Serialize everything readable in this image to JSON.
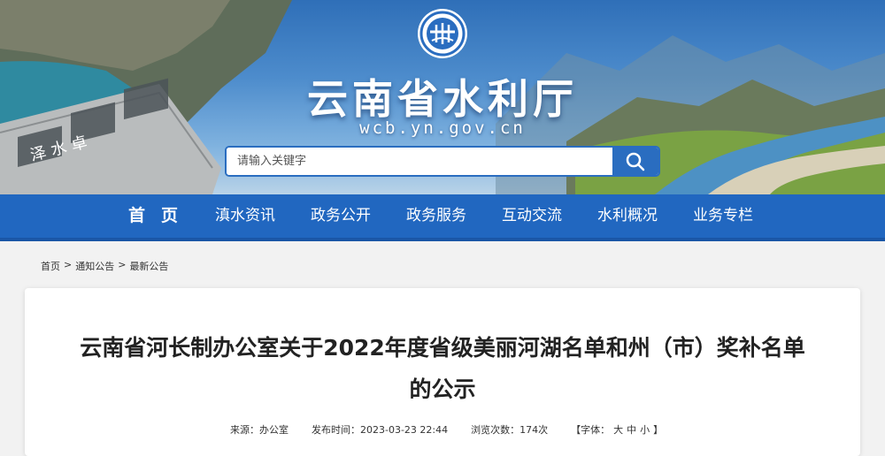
{
  "header": {
    "site_title": "云南省水利厅",
    "site_domain": "wcb.yn.gov.cn",
    "dam_text": "泽 水 卓"
  },
  "search": {
    "placeholder": "请输入关键字"
  },
  "nav": {
    "items": [
      "首页",
      "滇水资讯",
      "政务公开",
      "政务服务",
      "互动交流",
      "水利概况",
      "业务专栏"
    ]
  },
  "breadcrumb": {
    "items": [
      "首页",
      "通知公告",
      "最新公告"
    ],
    "separator": ">"
  },
  "article": {
    "title": "云南省河长制办公室关于2022年度省级美丽河湖名单和州（市）奖补名单的公示",
    "meta": {
      "source": "来源：办公室",
      "published": "发布时间：2023-03-23 22:44",
      "views": "浏览次数：174次",
      "font_label": "【字体：",
      "font_large": "大",
      "font_medium": "中",
      "font_small": "小",
      "font_close": "】"
    }
  },
  "colors": {
    "nav_bg": "#2167c0",
    "accent": "#2a6dc0",
    "page_bg": "#f2f2f2"
  },
  "icons": {
    "logo": "water-emblem-icon",
    "search": "search-icon"
  }
}
